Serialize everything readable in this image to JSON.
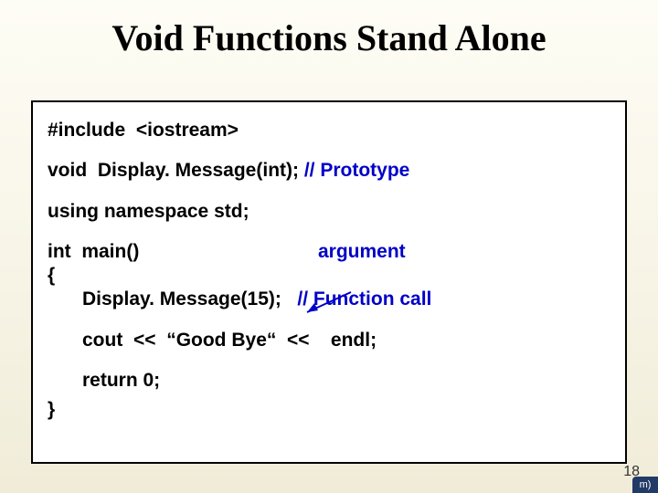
{
  "title": "Void Functions Stand Alone",
  "code": {
    "include": "#include  <iostream>",
    "proto_prefix": "void  Display. Message(int); ",
    "proto_comment": "// Prototype",
    "usingns": "using namespace std;",
    "main_sig": "int  main()",
    "argument_label": "argument",
    "brace_open": "{",
    "call_prefix": "Display. Message(15);   ",
    "call_comment": "// Function call",
    "cout_line": "cout  <<  “Good Bye“  <<    endl;",
    "return_line": "return 0;",
    "brace_close": "}"
  },
  "page_number": "18",
  "corner_fragment": "m)"
}
